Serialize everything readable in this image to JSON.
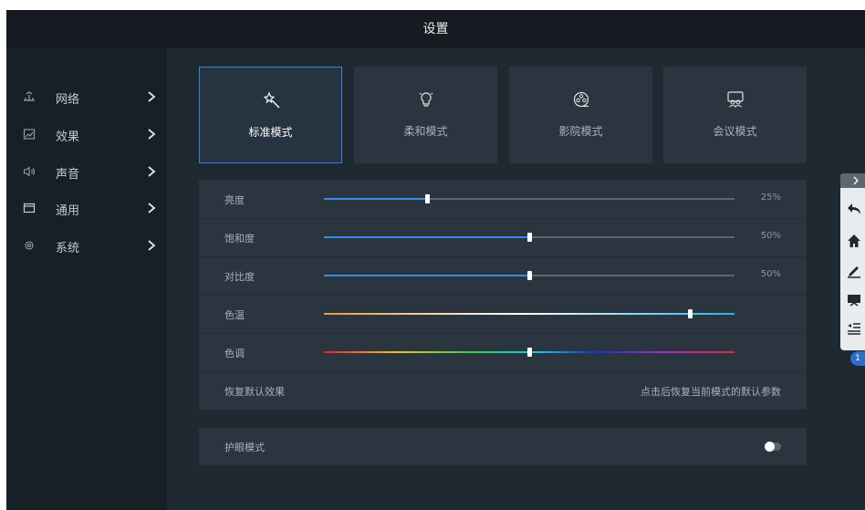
{
  "window": {
    "title": "设置"
  },
  "sidebar": {
    "items": [
      {
        "label": "网络",
        "icon": "network-icon"
      },
      {
        "label": "效果",
        "icon": "chart-icon"
      },
      {
        "label": "声音",
        "icon": "speaker-icon"
      },
      {
        "label": "通用",
        "icon": "window-icon"
      },
      {
        "label": "系统",
        "icon": "gear-icon"
      }
    ]
  },
  "modes": [
    {
      "label": "标准模式",
      "icon": "magic-wand-icon",
      "active": true
    },
    {
      "label": "柔和模式",
      "icon": "lightbulb-icon",
      "active": false
    },
    {
      "label": "影院模式",
      "icon": "film-reel-icon",
      "active": false
    },
    {
      "label": "会议模式",
      "icon": "meeting-icon",
      "active": false
    }
  ],
  "sliders": {
    "brightness": {
      "label": "亮度",
      "value": 0.25,
      "value_text": "25%"
    },
    "saturation": {
      "label": "饱和度",
      "value": 0.5,
      "value_text": "50%"
    },
    "contrast": {
      "label": "对比度",
      "value": 0.5,
      "value_text": "50%"
    },
    "temperature": {
      "label": "色温",
      "value": 0.89
    },
    "hue": {
      "label": "色调",
      "value": 0.5
    }
  },
  "reset": {
    "label": "恢复默认效果",
    "hint": "点击后恢复当前模式的默认参数"
  },
  "eye_protection": {
    "label": "护眼模式",
    "enabled": false
  },
  "floating_toolbar": {
    "buttons": [
      "back-icon",
      "home-icon",
      "pen-icon",
      "whiteboard-icon",
      "menu-icon"
    ],
    "badge": "1"
  },
  "colors": {
    "accent": "#3b88e6",
    "active_border": "#3b7fe0",
    "background": "#1e2932",
    "panel": "#2a3540"
  }
}
